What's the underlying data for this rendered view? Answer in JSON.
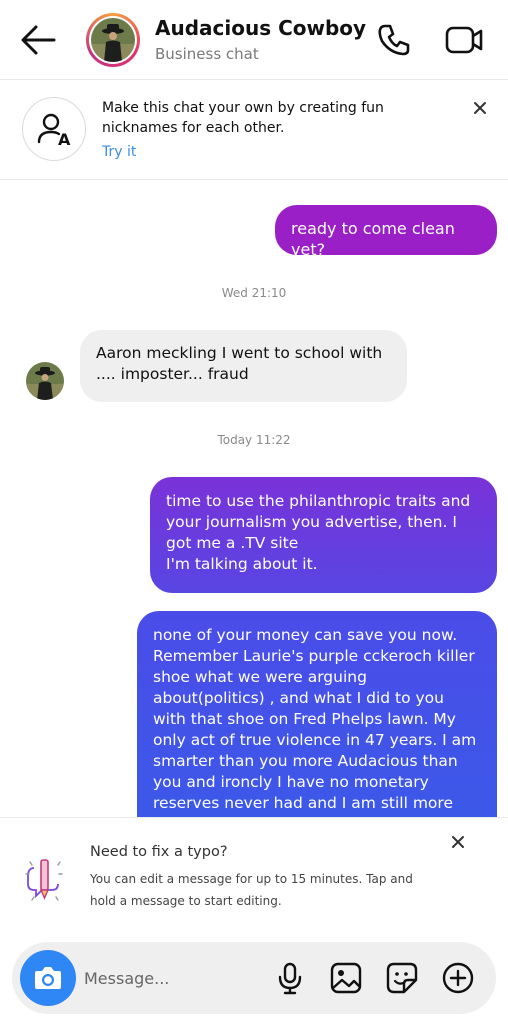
{
  "header": {
    "title": "Audacious Cowboy",
    "subtitle": "Business chat",
    "icons": [
      "back-arrow-icon",
      "phone-icon",
      "video-camera-icon"
    ]
  },
  "banner": {
    "text": "Make this chat your own by creating fun nicknames for each other.",
    "link": "Try it",
    "icon": "nickname-icon"
  },
  "messages": [
    {
      "from": "me",
      "text": "ready to come clean yet?"
    },
    {
      "timestamp": "Wed 21:10"
    },
    {
      "from": "them",
      "text": "Aaron meckling I went to school with .... imposter... fraud"
    },
    {
      "timestamp": "Today 11:22"
    },
    {
      "from": "me",
      "text": "time to use the philanthropic traits and your journalism you advertise, then.  I got me a .TV site\nI'm talking about it."
    },
    {
      "from": "me",
      "text": "none of your money can save you now. Remember Laurie's purple cckeroch killer shoe what we were arguing about(politics) , and what I did to you with that shoe on Fred Phelps lawn. My only act of true violence in 47 years. I am smarter than you more Audacious than you and ironcly I have no monetary reserves never had and I am still more powerful than you"
    }
  ],
  "tip": {
    "title": "Need to fix a typo?",
    "body": "You can edit a message for up to 15 minutes. Tap and hold a message to start editing."
  },
  "composer": {
    "placeholder": "Message...",
    "icons": [
      "camera-icon",
      "microphone-icon",
      "gallery-icon",
      "sticker-icon",
      "plus-icon"
    ]
  },
  "colors": {
    "accent_blue": "#3b8fe0",
    "camera_blue": "#2f86f5",
    "bubble_purple": "#9b1fc6",
    "bubble_indigo": "#4b4ce8",
    "incoming_gray": "#efefef"
  }
}
